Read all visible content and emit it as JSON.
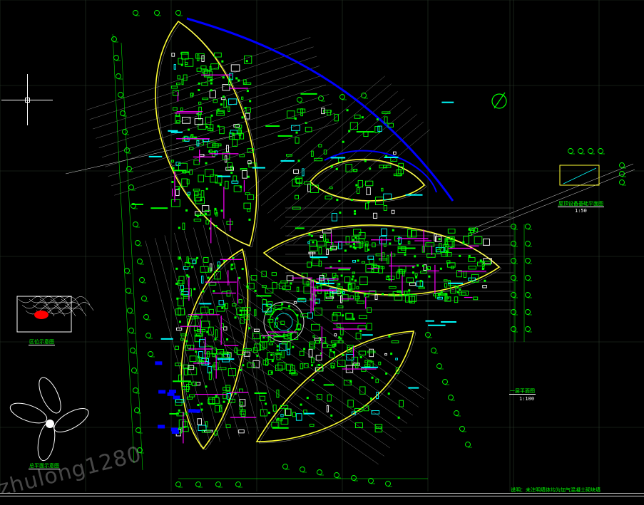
{
  "viewport": {
    "background": "#000000"
  },
  "colors": {
    "grid": "#2a3a2a",
    "axis": "#d9d9d9",
    "wall": "#ffff33",
    "structure": "#00ff00",
    "pipe": "#ff00ff",
    "arc": "#0000ff",
    "cyan": "#00ffff",
    "white": "#ffffff",
    "red": "#ff0000"
  },
  "labels": {
    "plan_title": "一层平面图",
    "plan_scale": "1:100",
    "detail_title": "屋顶设备基础平面图",
    "detail_scale": "1:50",
    "location_title": "区位示意图",
    "orientation_title": "总平面示意图",
    "bottom_note": "说明：未注明墙体均为加气混凝土砌块墙",
    "watermark": "zhulong1280"
  },
  "icons": {
    "north_arrow": "north-arrow-icon",
    "crosshair": "crosshair-cursor-icon",
    "ucs": "ucs-icon"
  }
}
